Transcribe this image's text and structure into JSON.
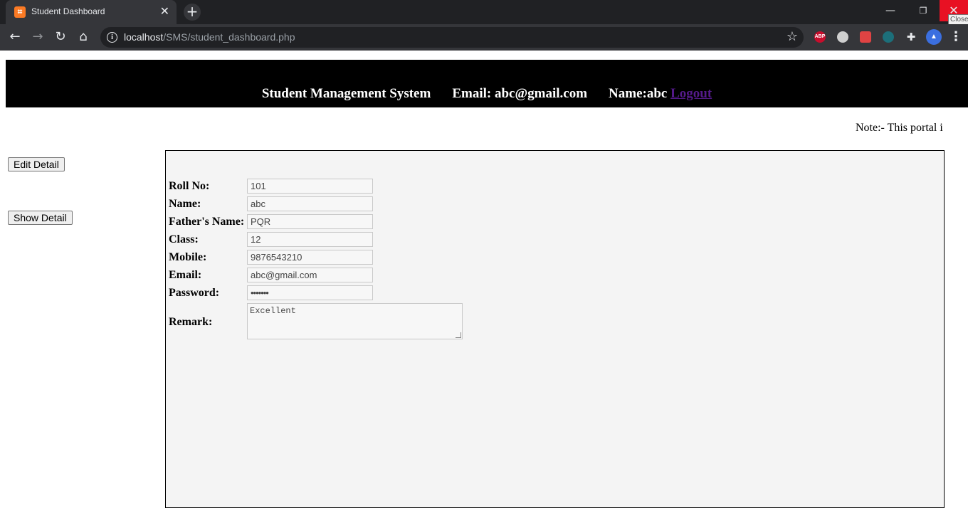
{
  "browser": {
    "tab_title": "Student Dashboard",
    "tab_close": "✕",
    "new_tab": "+",
    "url_host": "localhost",
    "url_path": "/SMS/student_dashboard.php",
    "close_tooltip": "Close",
    "extensions": [
      "ABP"
    ]
  },
  "header": {
    "title": "Student Management System",
    "email": "Email: abc@gmail.com",
    "name": "Name:abc",
    "logout": "Logout"
  },
  "note": "Note:- This portal i",
  "sidebar": {
    "edit_button": "Edit Detail",
    "show_button": "Show Detail"
  },
  "form": {
    "fields": [
      {
        "label": "Roll No:",
        "value": "101"
      },
      {
        "label": "Name:",
        "value": "abc"
      },
      {
        "label": "Father's Name:",
        "value": "PQR"
      },
      {
        "label": "Class:",
        "value": "12"
      },
      {
        "label": "Mobile:",
        "value": "9876543210"
      },
      {
        "label": "Email:",
        "value": "abc@gmail.com"
      },
      {
        "label": "Password:",
        "value": "•••••••"
      }
    ],
    "remark_label": "Remark:",
    "remark_value": "Excellent"
  },
  "colors": {
    "header_bg": "#000000",
    "logout_link": "#551a8b",
    "panel_bg": "#f4f4f4",
    "browser_close": "#e81123"
  }
}
